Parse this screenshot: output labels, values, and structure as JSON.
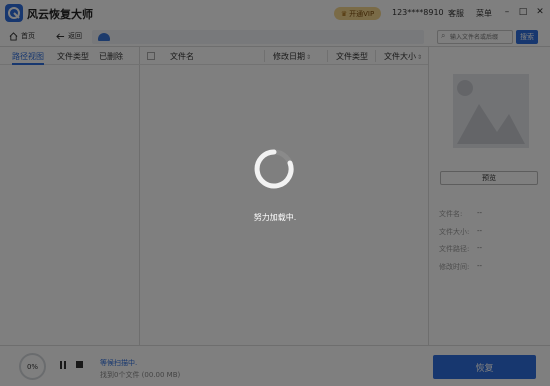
{
  "titlebar": {
    "app_title": "风云恢复大师",
    "vip_label": "开通VIP",
    "account": "123****8910",
    "service_label": "客服",
    "menu_label": "菜单",
    "minimize": "–",
    "maximize": "□",
    "close": "✕"
  },
  "toolbar": {
    "home_label": "首页",
    "back_label": "返回",
    "search_placeholder": "输入文件名或后缀",
    "search_button": "搜索"
  },
  "left_tabs": [
    {
      "label": "路径视图",
      "active": true
    },
    {
      "label": "文件类型",
      "active": false
    },
    {
      "label": "已删除",
      "active": false
    }
  ],
  "columns": {
    "name": "文件名",
    "modified": "修改日期",
    "type": "文件类型",
    "size": "文件大小"
  },
  "preview": {
    "button_label": "预览",
    "fields": [
      {
        "label": "文件名:",
        "value": "--"
      },
      {
        "label": "文件大小:",
        "value": "--"
      },
      {
        "label": "文件路径:",
        "value": "--"
      },
      {
        "label": "修改时间:",
        "value": "--"
      }
    ]
  },
  "bottom": {
    "progress": "0%",
    "scan_status": "等候扫描中.",
    "found_text": "找到0个文件 (00.00 MB)",
    "recover_label": "恢复"
  },
  "overlay": {
    "loading_text": "努力加载中."
  },
  "colors": {
    "accent": "#2f6fde",
    "vip_gold": "#f5d68f",
    "overlay": "rgba(0,0,0,0.5)"
  }
}
